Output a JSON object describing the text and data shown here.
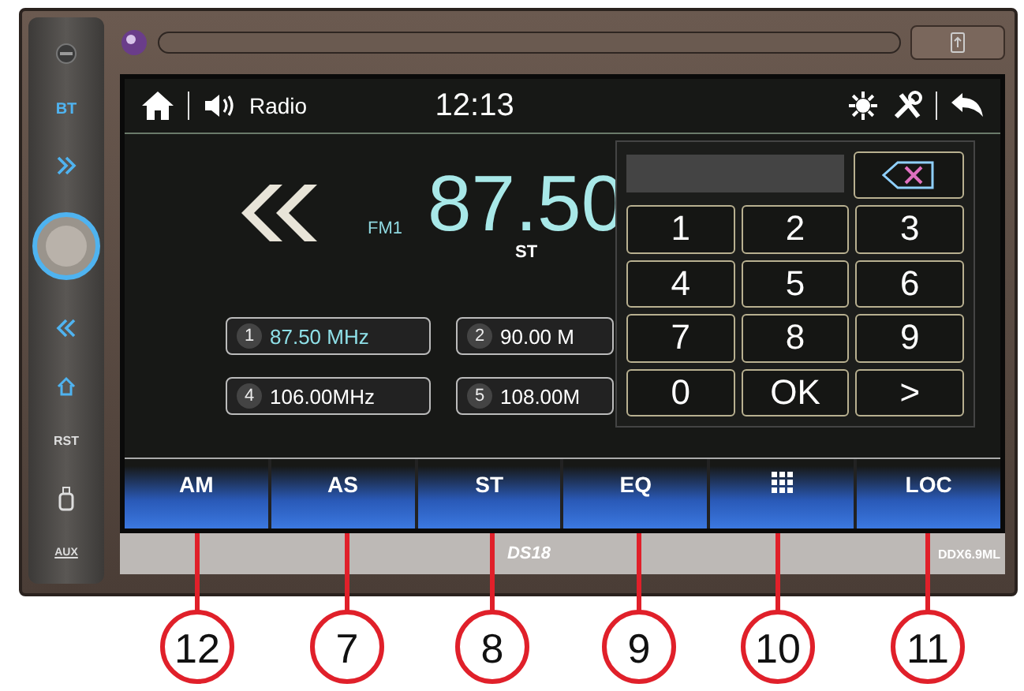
{
  "device": {
    "side_labels": [
      "BT",
      "RST",
      "AUX"
    ],
    "brand": "DS18",
    "model": "DDX6.9ML"
  },
  "header": {
    "title": "Radio",
    "clock": "12:13"
  },
  "tuner": {
    "band": "FM1",
    "frequency": "87.50",
    "stereo": "ST"
  },
  "presets": [
    {
      "number": "1",
      "frequency": "87.50 MHz",
      "selected": true
    },
    {
      "number": "2",
      "frequency": "90.00 M",
      "selected": false
    },
    {
      "number": "4",
      "frequency": "106.00MHz",
      "selected": false
    },
    {
      "number": "5",
      "frequency": "108.00M",
      "selected": false
    }
  ],
  "keypad": {
    "keys": [
      "1",
      "2",
      "3",
      "4",
      "5",
      "6",
      "7",
      "8",
      "9",
      "0",
      "OK",
      ">"
    ]
  },
  "bottom_buttons": [
    {
      "kind": "text",
      "label": "AM"
    },
    {
      "kind": "text",
      "label": "AS"
    },
    {
      "kind": "text",
      "label": "ST"
    },
    {
      "kind": "text",
      "label": "EQ"
    },
    {
      "kind": "grid"
    },
    {
      "kind": "text",
      "label": "LOC"
    }
  ],
  "callouts": [
    "12",
    "7",
    "8",
    "9",
    "10",
    "11"
  ]
}
